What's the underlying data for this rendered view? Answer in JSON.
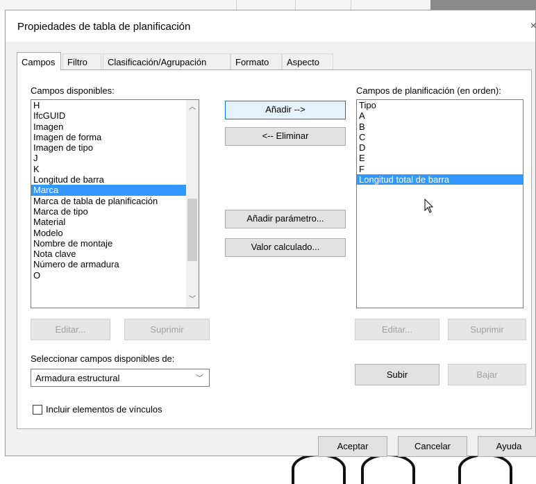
{
  "dialog": {
    "title": "Propiedades de tabla de planificación",
    "close_icon": "×"
  },
  "tabs": [
    {
      "label": "Campos",
      "active": true
    },
    {
      "label": "Filtro",
      "active": false
    },
    {
      "label": "Clasificación/Agrupación",
      "active": false
    },
    {
      "label": "Formato",
      "active": false
    },
    {
      "label": "Aspecto",
      "active": false
    }
  ],
  "available": {
    "label": "Campos disponibles:",
    "items": [
      "H",
      "IfcGUID",
      "Imagen",
      "Imagen de forma",
      "Imagen de tipo",
      "J",
      "K",
      "Longitud de barra",
      "Marca",
      "Marca de tabla de planificación",
      "Marca de tipo",
      "Material",
      "Modelo",
      "Nombre de montaje",
      "Nota clave",
      "Número de armadura",
      "O"
    ],
    "selected_index": 8,
    "edit_label": "Editar...",
    "delete_label": "Suprimir"
  },
  "middle_buttons": {
    "add": "Añadir -->",
    "remove": "<-- Eliminar",
    "add_param": "Añadir parámetro...",
    "calc_value": "Valor calculado..."
  },
  "scheduled": {
    "label": "Campos de planificación (en orden):",
    "items": [
      "Tipo",
      "A",
      "B",
      "C",
      "D",
      "E",
      "F",
      "Longitud total de barra"
    ],
    "selected_index": 7,
    "edit_label": "Editar...",
    "delete_label": "Suprimir",
    "up_label": "Subir",
    "down_label": "Bajar"
  },
  "select_from": {
    "label": "Seleccionar campos disponibles de:",
    "value": "Armadura estructural"
  },
  "include_links": {
    "label": "Incluir elementos de vínculos",
    "checked": false
  },
  "footer": {
    "ok": "Aceptar",
    "cancel": "Cancelar",
    "help": "Ayuda"
  },
  "colors": {
    "selection": "#3399ff",
    "dialog_bg": "#f0f0f0",
    "primary_border": "#0078d7"
  }
}
